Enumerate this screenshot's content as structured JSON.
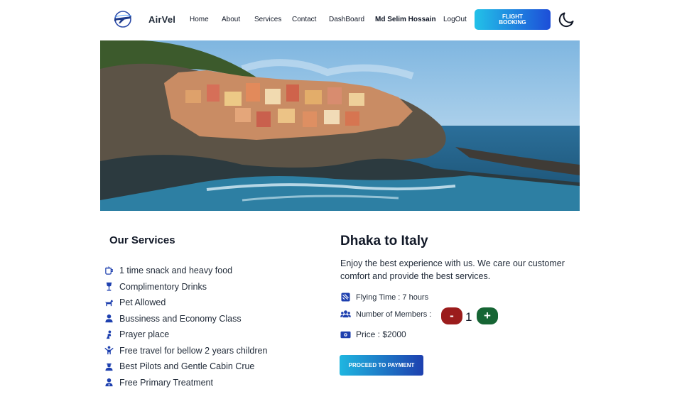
{
  "brand": {
    "name": "AirVel",
    "logo_icon": "airplane-logo-icon"
  },
  "nav": {
    "home": "Home",
    "about": "About",
    "services": "Services",
    "contact": "Contact",
    "dashboard": "DashBoard",
    "user": "Md Selim Hossain",
    "logout": "LogOut",
    "booking_button": "FLIGHT BOOKING",
    "theme_icon": "moon-icon"
  },
  "hero": {
    "alt": "coastal-village-photo"
  },
  "services": {
    "title": "Our Services",
    "items": [
      {
        "label": "1 time snack and heavy food",
        "icon": "mug-icon"
      },
      {
        "label": "Complimentory Drinks",
        "icon": "glass-icon"
      },
      {
        "label": "Pet Allowed",
        "icon": "dog-icon"
      },
      {
        "label": "Bussiness and Economy Class",
        "icon": "user-icon"
      },
      {
        "label": "Prayer place",
        "icon": "praying-icon"
      },
      {
        "label": "Free travel for bellow 2 years children",
        "icon": "child-icon"
      },
      {
        "label": "Best Pilots and Gentle Cabin Crue",
        "icon": "pilot-icon"
      },
      {
        "label": "Free Primary Treatment",
        "icon": "doctor-icon"
      }
    ]
  },
  "trip": {
    "title": "Dhaka to Italy",
    "description": "Enjoy the best experience with us. We care our customer comfort and provide the best services.",
    "flying_time": "Flying Time : 7 hours",
    "members_label": "Number of Members :",
    "member_count": "1",
    "minus_label": "-",
    "plus_label": "+",
    "price": "Price : $2000",
    "pay_button": "PROCEED TO PAYMENT"
  },
  "colors": {
    "accent_gradient_start": "#22c1e8",
    "accent_gradient_end": "#1d4ed8",
    "minus": "#9b1c1c",
    "plus": "#166534",
    "icon_blue": "#1e40af"
  }
}
